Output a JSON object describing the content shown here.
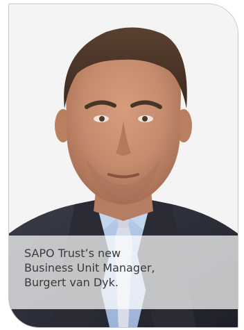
{
  "caption": {
    "lines": [
      "SAPO Trust’s new",
      "Business Unit Manager,",
      "Burgert van Dyk."
    ]
  },
  "photo": {
    "subject": "portrait-photo",
    "background_color": "#f4f4f4",
    "suit_color": "#2b2d38",
    "shirt_color": "#a9bfe0",
    "skin_color": "#c48b6d",
    "hair_color": "#4a3426"
  }
}
